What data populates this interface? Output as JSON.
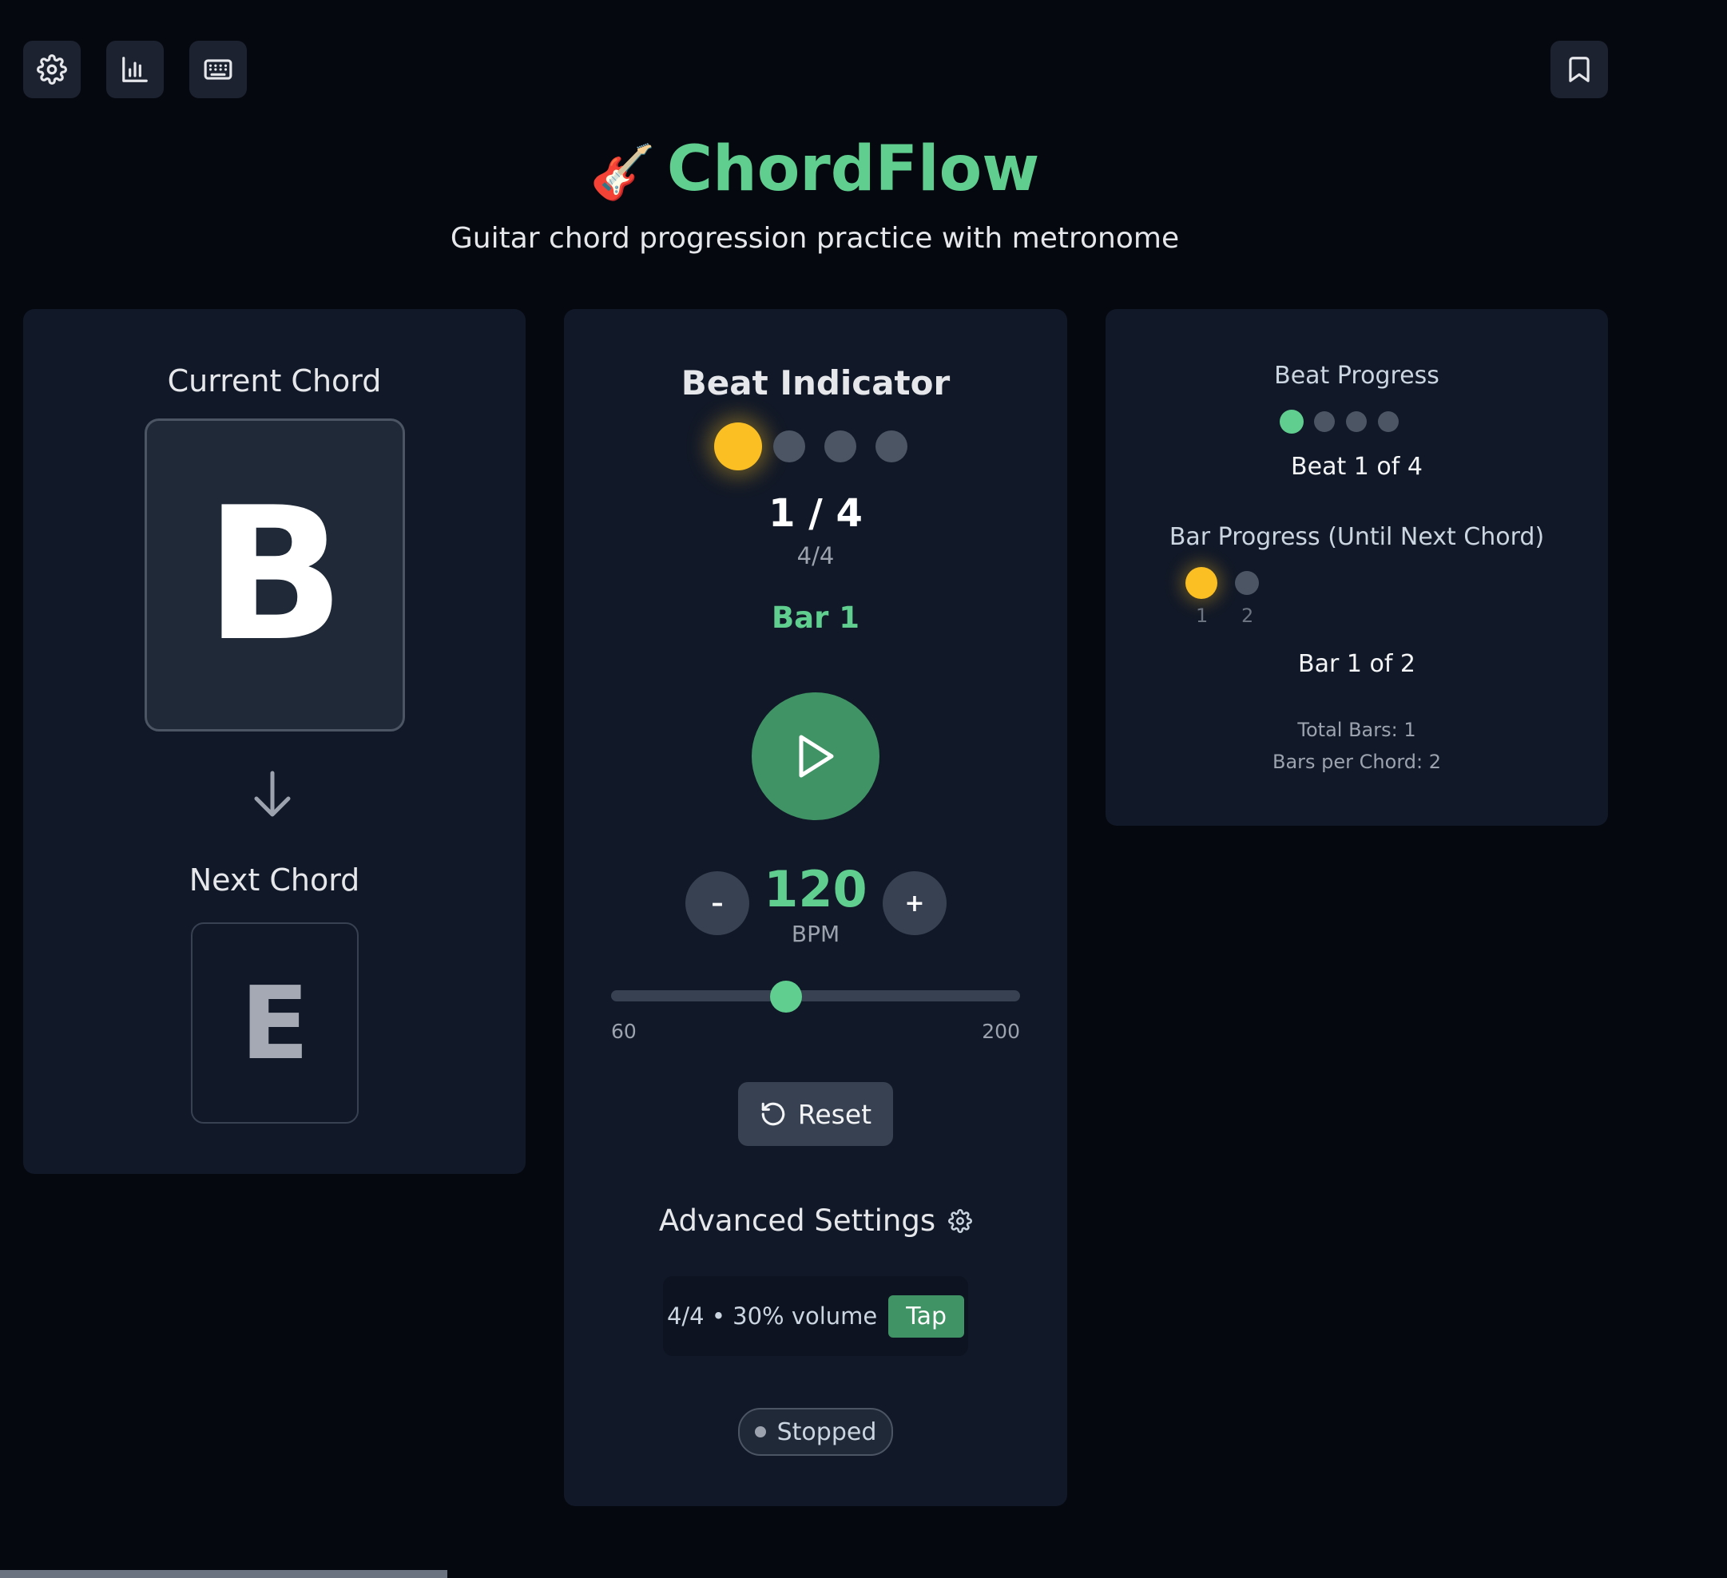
{
  "toolbar": {
    "settings_icon": "gear-icon",
    "stats_icon": "bar-chart-icon",
    "keyboard_icon": "keyboard-icon",
    "bookmark_icon": "bookmark-icon"
  },
  "header": {
    "emoji": "🎸",
    "title": "ChordFlow",
    "subtitle": "Guitar chord progression practice with metronome"
  },
  "chords": {
    "current_label": "Current Chord",
    "current": "B",
    "next_label": "Next Chord",
    "next": "E"
  },
  "beat": {
    "title": "Beat Indicator",
    "beats_total": 4,
    "active_beat": 1,
    "counter": "1 / 4",
    "time_signature": "4/4",
    "bar_label": "Bar 1"
  },
  "tempo": {
    "minus": "–",
    "plus": "+",
    "bpm": "120",
    "bpm_label": "BPM",
    "min": "60",
    "max": "200",
    "slider_value": 120
  },
  "actions": {
    "reset_label": "Reset"
  },
  "advanced": {
    "title": "Advanced Settings",
    "summary": "4/4 • 30% volume",
    "tap_label": "Tap"
  },
  "status": {
    "label": "Stopped"
  },
  "progress": {
    "beat_title": "Beat Progress",
    "beat_text": "Beat 1 of 4",
    "bar_title": "Bar Progress (Until Next Chord)",
    "bar_numbers": [
      "1",
      "2"
    ],
    "bar_text": "Bar 1 of 2",
    "total_bars": "Total Bars: 1",
    "bars_per_chord": "Bars per Chord: 2"
  },
  "colors": {
    "accent_green": "#5fce8f",
    "beat_active": "#fbbf24",
    "background": "#05080f",
    "card": "#111827"
  }
}
